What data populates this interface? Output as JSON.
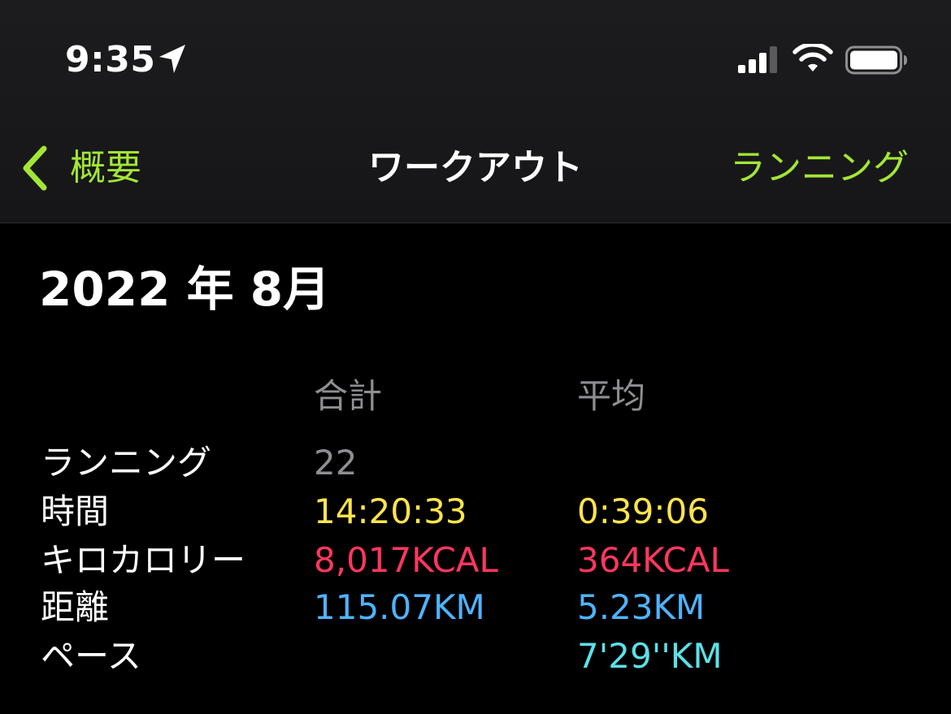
{
  "status_bar": {
    "time": "9:35"
  },
  "nav": {
    "back_label": "概要",
    "title": "ワークアウト",
    "right_label": "ランニング"
  },
  "month_title": "2022 年 8月",
  "columns": {
    "total": "合計",
    "average": "平均"
  },
  "rows": [
    {
      "label": "ランニング",
      "total": "22",
      "average": ""
    },
    {
      "label": "時間",
      "total": "14:20:33",
      "average": "0:39:06"
    },
    {
      "label": "キロカロリー",
      "total": "8,017KCAL",
      "average": "364KCAL"
    },
    {
      "label": "距離",
      "total": "115.07KM",
      "average": "5.23KM"
    },
    {
      "label": "ペース",
      "total": "",
      "average": "7'29''KM"
    }
  ],
  "colors": {
    "accent_green": "#a3e635",
    "count_gray": "#8e8e93",
    "time_yellow": "#ffe44d",
    "calories_red": "#ff375f",
    "distance_blue": "#4fb3ff",
    "pace_cyan": "#5ce1e6"
  },
  "icons": {
    "location": "location-arrow-icon",
    "signal": "cellular-signal-icon",
    "wifi": "wifi-icon",
    "battery": "battery-icon",
    "back": "chevron-left-icon"
  }
}
